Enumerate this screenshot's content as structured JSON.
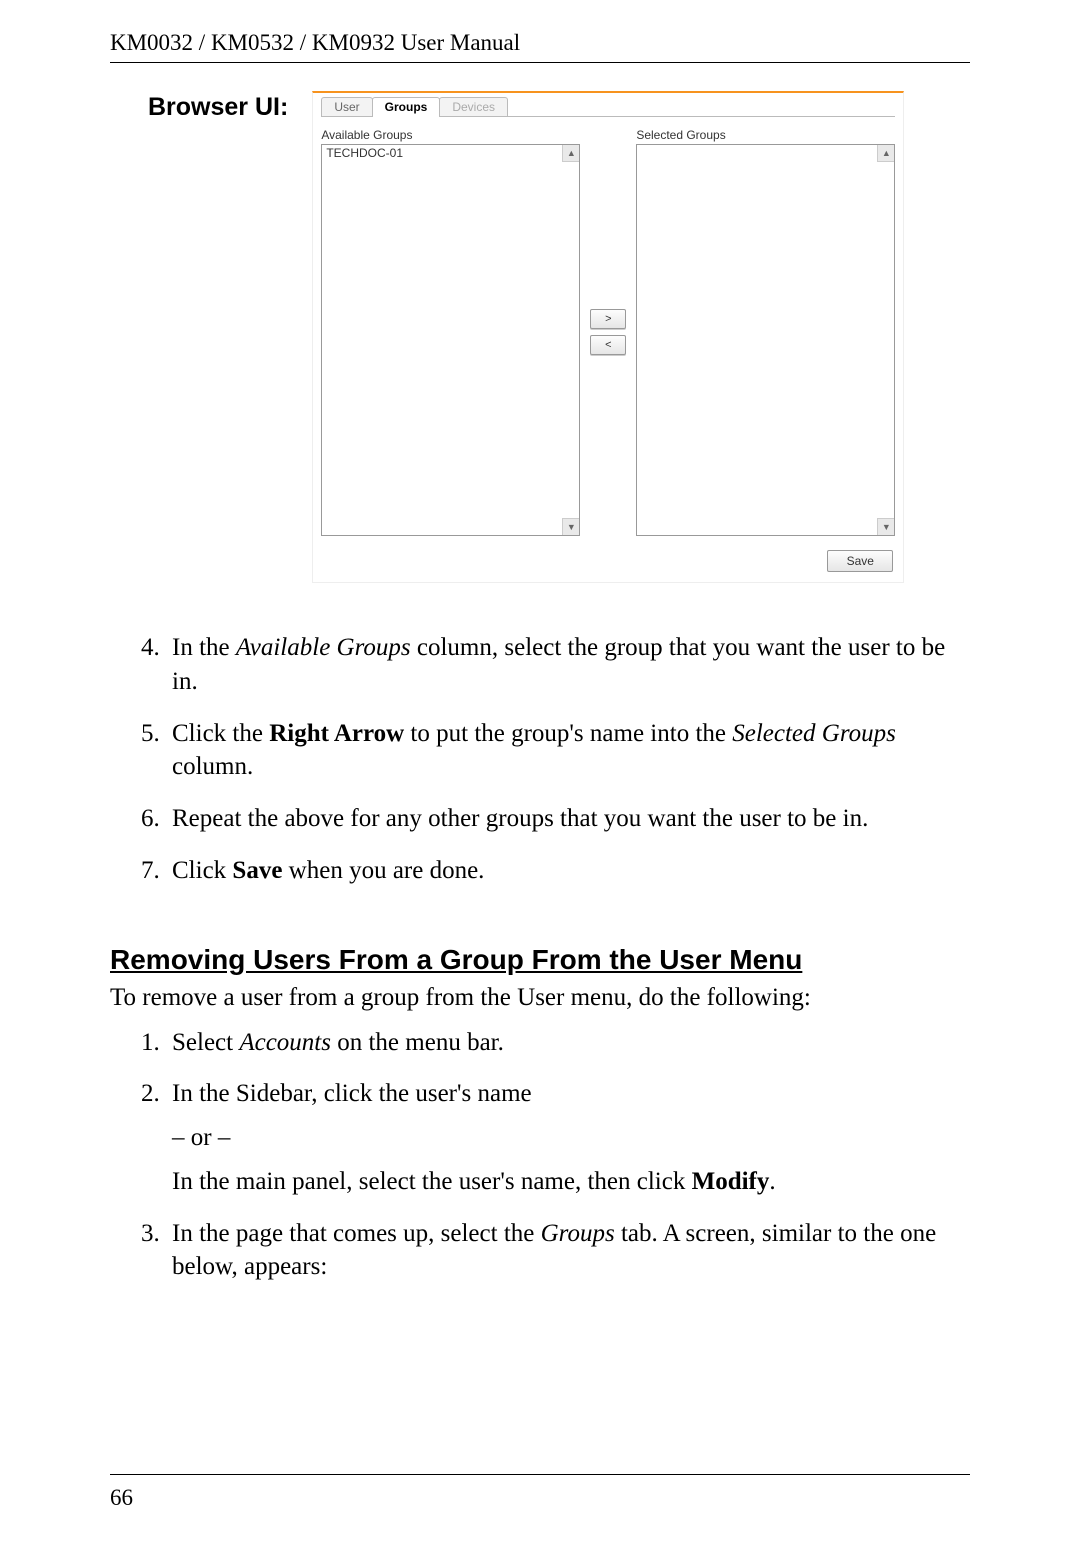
{
  "header": {
    "title": "KM0032 / KM0532 / KM0932 User Manual"
  },
  "labels": {
    "browser_ui": "Browser UI:"
  },
  "screenshot": {
    "tabs": {
      "user": "User",
      "groups": "Groups",
      "devices": "Devices"
    },
    "available_label": "Available Groups",
    "selected_label": "Selected Groups",
    "available_items": [
      "TECHDOC-01"
    ],
    "selected_items": [],
    "btn_right": ">",
    "btn_left": "<",
    "btn_save": "Save",
    "scroll_up": "▲",
    "scroll_down": "▼"
  },
  "steps_a": {
    "s4a": "In the ",
    "s4b": "Available Groups",
    "s4c": " column, select the group that you want the user to be in.",
    "s5a": "Click the ",
    "s5b": "Right Arrow",
    "s5c": " to put the group's name into the ",
    "s5d": "Selected Groups",
    "s5e": " column.",
    "s6": "Repeat the above for any other groups that you want the user to be in.",
    "s7a": "Click ",
    "s7b": "Save",
    "s7c": " when you are done."
  },
  "section2": {
    "heading": "Removing Users From a Group From the User Menu",
    "intro": "To remove a user from a group from the User menu, do the following:",
    "s1a": "Select ",
    "s1b": "Accounts",
    "s1c": " on the menu bar.",
    "s2": "In the Sidebar, click the user's name",
    "or": "– or –",
    "s2b_a": "In the main panel, select the user's name, then click ",
    "s2b_b": "Modify",
    "s2b_c": ".",
    "s3a": "In the page that comes up, select the ",
    "s3b": "Groups",
    "s3c": " tab. A screen, similar to the one below, appears:"
  },
  "footer": {
    "page": "66"
  }
}
